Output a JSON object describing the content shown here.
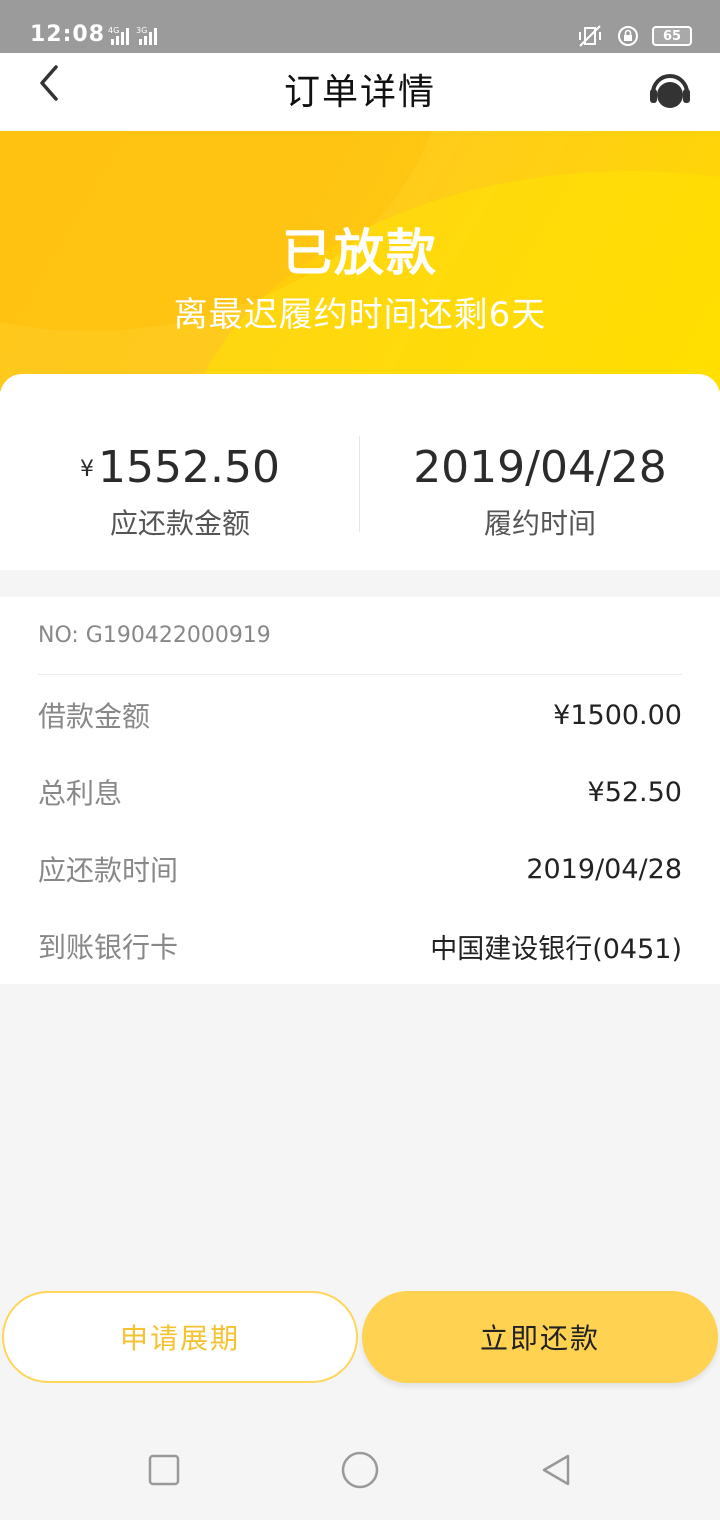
{
  "status_bar": {
    "time": "12:08",
    "net1": "4G",
    "net2": "3G",
    "battery": "65"
  },
  "nav": {
    "title": "订单详情"
  },
  "banner": {
    "status": "已放款",
    "subtitle": "离最迟履约时间还剩6天"
  },
  "summary": {
    "amount_currency": "¥",
    "amount": "1552.50",
    "amount_label": "应还款金额",
    "date": "2019/04/28",
    "date_label": "履约时间"
  },
  "details": {
    "order_no": "NO: G190422000919",
    "rows": [
      {
        "key": "借款金额",
        "value": "¥1500.00"
      },
      {
        "key": "总利息",
        "value": "¥52.50"
      },
      {
        "key": "应还款时间",
        "value": "2019/04/28"
      },
      {
        "key": "到账银行卡",
        "value": "中国建设银行(0451)"
      }
    ]
  },
  "actions": {
    "extend": "申请展期",
    "repay": "立即还款"
  },
  "colors": {
    "accent": "#ffd351",
    "banner_yellow": "#ffc61a",
    "status_bar_gray": "#9b9b9b"
  }
}
